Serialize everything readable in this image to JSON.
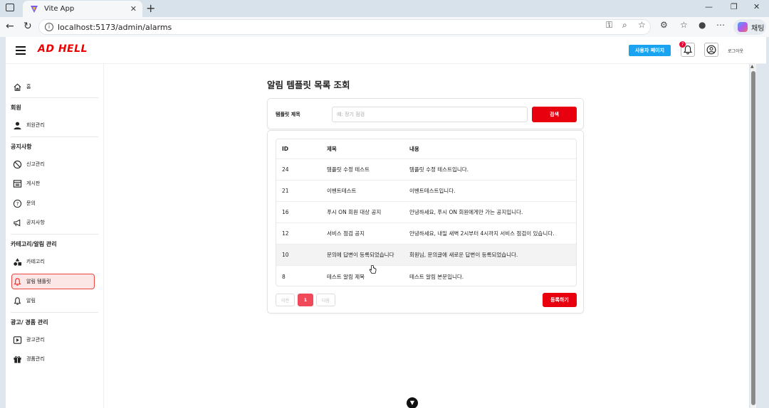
{
  "browser": {
    "tab_title": "Vite App",
    "url": "localhost:5173/admin/alarms",
    "chat_label": "채팅"
  },
  "header": {
    "logo": "AD HELL",
    "user_page_label": "사용자 페이지",
    "notification_count": "7",
    "logout_label": "로그아웃"
  },
  "sidebar": {
    "home": "홈",
    "section_members": "회원",
    "members": "회원관리",
    "section_notice": "공지사항",
    "reports": "신고관리",
    "board": "게시판",
    "inquiry": "문의",
    "notice": "공지사항",
    "section_category": "카테고리/알림 관리",
    "category": "카테고리",
    "alarm_templates": "알림 템플릿",
    "alarms": "알림",
    "section_ads": "광고/ 경품 관리",
    "ads": "광고관리",
    "prizes": "경품관리"
  },
  "main": {
    "title": "알림 템플릿 목록 조회",
    "search_label": "템플릿 제목",
    "search_placeholder": "예: 정기 점검",
    "search_value": "",
    "search_button": "검색",
    "columns": {
      "id": "ID",
      "title": "제목",
      "content": "내용"
    },
    "rows": [
      {
        "id": "24",
        "title": "템플릿 수정 테스트",
        "content": "템플릿 수정 테스트입니다."
      },
      {
        "id": "21",
        "title": "이벤트테스트",
        "content": "이벤트테스트입니다."
      },
      {
        "id": "16",
        "title": "푸시 ON 회원 대상 공지",
        "content": "안녕하세요, 푸시 ON 회원에게만 가는 공지입니다."
      },
      {
        "id": "12",
        "title": "서비스 점검 공지",
        "content": "안녕하세요, 내일 새벽 2시부터 4시까지 서비스 점검이 있습니다."
      },
      {
        "id": "10",
        "title": "문의에 답변이 등록되었습니다",
        "content": "회원님, 문의글에 새로운 답변이 등록되었습니다."
      },
      {
        "id": "8",
        "title": "테스트 알림 제목",
        "content": "테스트 알림 본문입니다."
      }
    ],
    "pager": {
      "prev": "이전",
      "current": "1",
      "next": "다음"
    },
    "register_button": "등록하기"
  },
  "colors": {
    "accent_red": "#e8000f",
    "user_page_blue": "#1aa3f0",
    "active_bg": "#fde6e6"
  }
}
